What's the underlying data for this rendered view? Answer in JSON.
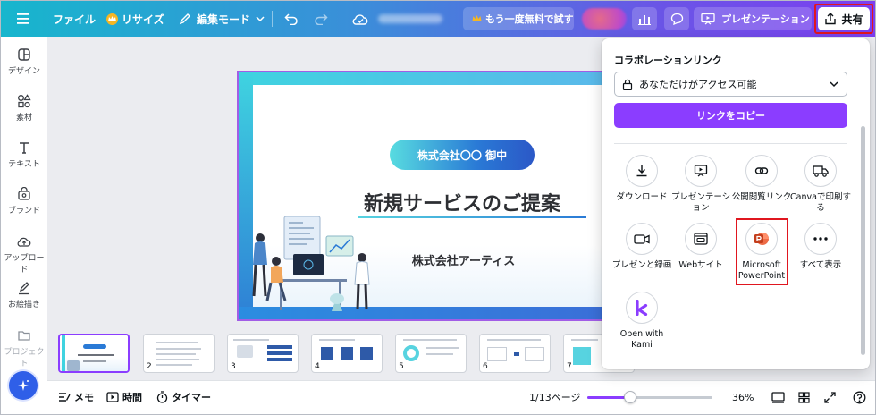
{
  "topbar": {
    "menu_icon": "hamburger-icon",
    "file_label": "ファイル",
    "resize_label": "リサイズ",
    "edit_mode_label": "編集モード",
    "try_free_label": "もう一度無料で試す",
    "present_label": "プレゼンテーション",
    "share_label": "共有"
  },
  "rail": {
    "items": [
      {
        "label": "デザイン",
        "icon": "layout-icon"
      },
      {
        "label": "素材",
        "icon": "shapes-icon"
      },
      {
        "label": "テキスト",
        "icon": "text-icon"
      },
      {
        "label": "ブランド",
        "icon": "brand-icon"
      },
      {
        "label": "アップロード",
        "icon": "upload-cloud-icon"
      },
      {
        "label": "お絵描き",
        "icon": "draw-icon"
      },
      {
        "label": "プロジェクト",
        "icon": "folder-icon"
      }
    ]
  },
  "slide": {
    "company_pill": "株式会社〇〇 御中",
    "title": "新規サービスのご提案",
    "subtitle": "株式会社アーティス"
  },
  "filmstrip": {
    "thumbs": [
      "",
      "2",
      "3",
      "4",
      "5",
      "6",
      "7"
    ]
  },
  "bottombar": {
    "notes_label": "メモ",
    "timer_label": "時間",
    "stopwatch_label": "タイマー",
    "page_label": "1/13ページ",
    "zoom_label": "36%",
    "zoom_fraction": 0.36
  },
  "share": {
    "title": "コラボレーションリンク",
    "access": "あなただけがアクセス可能",
    "copy_label": "リンクをコピー",
    "options": [
      {
        "label": "ダウンロード",
        "icon": "download-icon"
      },
      {
        "label": "プレゼンテーション",
        "icon": "presentation-icon"
      },
      {
        "label": "公開閲覧リンク",
        "icon": "link-icon"
      },
      {
        "label": "Canvaで印刷する",
        "icon": "truck-icon"
      },
      {
        "label": "プレゼンと録画",
        "icon": "video-camera-icon"
      },
      {
        "label": "Webサイト",
        "icon": "website-icon"
      },
      {
        "label": "Microsoft PowerPoint",
        "icon": "powerpoint-icon"
      },
      {
        "label": "すべて表示",
        "icon": "more-dots-icon"
      },
      {
        "label": "Open with Kami",
        "icon": "kami-icon"
      }
    ]
  },
  "colors": {
    "accent": "#8b3dff",
    "highlight": "#e0161f"
  }
}
